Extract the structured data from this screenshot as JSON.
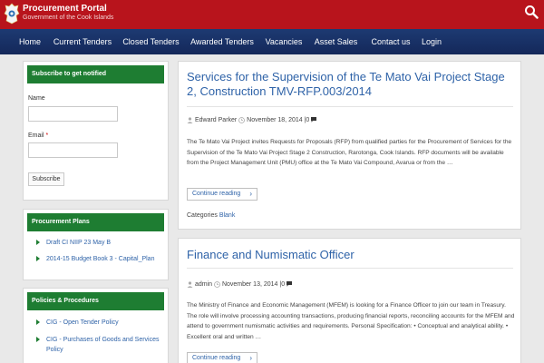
{
  "header": {
    "title": "Procurement Portal",
    "subtitle": "Government of the Cook Islands",
    "brand_color": "#b8141c",
    "search_icon": "search-icon"
  },
  "nav": {
    "items": [
      {
        "label": "Home"
      },
      {
        "label": "Current Tenders"
      },
      {
        "label": "Closed Tenders"
      },
      {
        "label": "Awarded Tenders"
      },
      {
        "label": "Vacancies"
      },
      {
        "label": "Asset Sales"
      },
      {
        "label": "Contact us"
      },
      {
        "label": "Login"
      }
    ]
  },
  "sidebar": {
    "subscribe": {
      "heading": "Subscribe to get notified",
      "name_label": "Name",
      "name_value": "",
      "email_label": "Email",
      "email_required": "*",
      "email_value": "",
      "button_label": "Subscribe"
    },
    "plans": {
      "heading": "Procurement Plans",
      "items": [
        {
          "label": "Draft CI NIIP 23 May B"
        },
        {
          "label": "2014-15 Budget Book 3 - Capital_Plan"
        }
      ]
    },
    "policies": {
      "heading": "Policies & Procedures",
      "items": [
        {
          "label": "CIG - Open Tender Policy"
        },
        {
          "label": "CIG - Purchases of Goods and Services Policy"
        }
      ]
    }
  },
  "posts": [
    {
      "title": "Services for the Supervision of the Te Mato Vai Project Stage 2, Construction TMV-RFP.003/2014",
      "author": "Edward Parker",
      "date": "November 18, 2014",
      "separator": "|",
      "comments": "0",
      "excerpt": "The Te Mato Vai Project invites Requests for Proposals (RFP) from qualified parties for the Procurement of Services for the Supervision of the Te Mato Vai Project Stage 2 Construction, Rarotonga, Cook Islands. RFP documents will be available from the Project Management Unit (PMU) office at the Te Mato Vai Compound, Avarua or from the …",
      "more_label": "Continue reading",
      "categories_label": "Categories",
      "category": "Blank"
    },
    {
      "title": "Finance and Numismatic Officer",
      "author": "admin",
      "date": "November 13, 2014",
      "separator": "|",
      "comments": "0",
      "excerpt": "The Ministry of Finance and Economic Management (MFEM) is looking for a Finance Officer to join our team in Treasury. The role will involve processing accounting transactions, producing financial reports, reconciling accounts for the MFEM and attend to government numismatic activities and requirements. Personal Specification: •    Conceptual and analytical ability. •    Excellent oral and written …",
      "more_label": "Continue reading"
    }
  ]
}
